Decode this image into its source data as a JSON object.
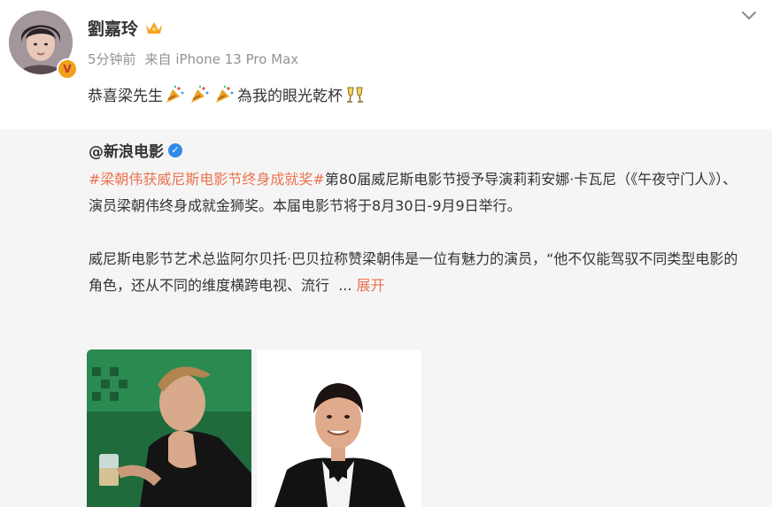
{
  "post": {
    "username": "劉嘉玲",
    "time": "5分钟前",
    "source": "来自 iPhone 13 Pro Max",
    "text_before": "恭喜梁先生",
    "text_after": "為我的眼光乾杯",
    "emoji_icons": [
      "party-popper-icon",
      "party-popper-icon",
      "party-popper-icon",
      "clinking-glasses-icon"
    ]
  },
  "repost": {
    "username": "@新浪电影",
    "hashtag": "#梁朝伟获威尼斯电影节终身成就奖#",
    "text_para1": "第80届威尼斯电影节授予导演莉莉安娜·卡瓦尼（《午夜守门人》）、演员梁朝伟终身成就金狮奖。本届电影节将于8月30日-9月9日举行。",
    "text_para2": "威尼斯电影节艺术总监阿尔贝托·巴贝拉称赞梁朝伟是一位有魅力的演员，“他不仅能驾驭不同类型电影的角色，还从不同的维度横跨电视、流行",
    "ellipsis": "...",
    "expand_label": "展开"
  },
  "colors": {
    "accent": "#eb7350",
    "verified_blue": "#2f8be6",
    "repost_bg": "#f5f5f5"
  }
}
